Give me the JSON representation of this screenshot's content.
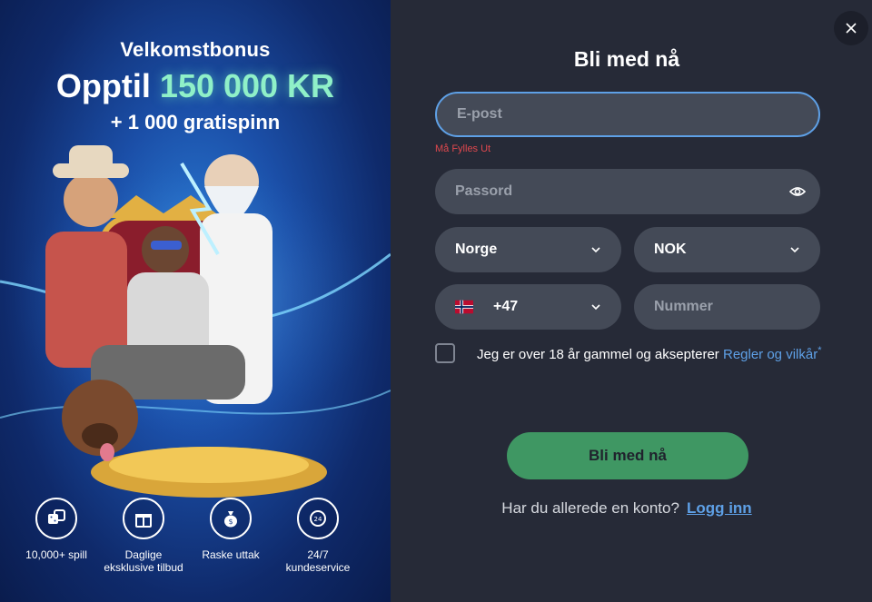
{
  "promo": {
    "title": "Velkomstbonus",
    "amount_prefix": "Opptil",
    "amount_value": "150 000 KR",
    "spins": "+ 1 000 gratispinn",
    "features": [
      {
        "icon": "dice-icon",
        "label": "10,000+ spill"
      },
      {
        "icon": "gift-icon",
        "label": "Daglige eksklusive tilbud"
      },
      {
        "icon": "money-bag-icon",
        "label": "Raske uttak"
      },
      {
        "icon": "support-24-icon",
        "label": "24/7 kundeservice"
      }
    ]
  },
  "form": {
    "title": "Bli med nå",
    "email_placeholder": "E-post",
    "email_error": "Må Fylles Ut",
    "password_placeholder": "Passord",
    "country_value": "Norge",
    "currency_value": "NOK",
    "phone_code": "+47",
    "number_placeholder": "Nummer",
    "terms_text": "Jeg er over 18 år gammel og aksepterer",
    "terms_link": "Regler og vilkår",
    "terms_star": "*",
    "submit_label": "Bli med nå",
    "login_question": "Har du allerede en konto?",
    "login_link": "Logg inn"
  },
  "colors": {
    "accent_green": "#3f9763",
    "link_blue": "#5ea0e6",
    "error_red": "#e0484e",
    "panel_bg": "#262a37"
  }
}
